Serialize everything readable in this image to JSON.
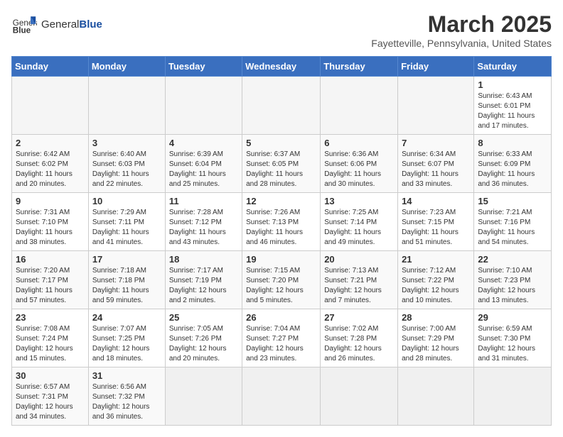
{
  "header": {
    "logo_text_normal": "General",
    "logo_text_bold": "Blue",
    "month_year": "March 2025",
    "location": "Fayetteville, Pennsylvania, United States"
  },
  "days_of_week": [
    "Sunday",
    "Monday",
    "Tuesday",
    "Wednesday",
    "Thursday",
    "Friday",
    "Saturday"
  ],
  "weeks": [
    [
      {
        "day": null,
        "info": null
      },
      {
        "day": null,
        "info": null
      },
      {
        "day": null,
        "info": null
      },
      {
        "day": null,
        "info": null
      },
      {
        "day": null,
        "info": null
      },
      {
        "day": null,
        "info": null
      },
      {
        "day": "1",
        "info": "Sunrise: 6:43 AM\nSunset: 6:01 PM\nDaylight: 11 hours and 17 minutes."
      }
    ],
    [
      {
        "day": "2",
        "info": "Sunrise: 6:42 AM\nSunset: 6:02 PM\nDaylight: 11 hours and 20 minutes."
      },
      {
        "day": "3",
        "info": "Sunrise: 6:40 AM\nSunset: 6:03 PM\nDaylight: 11 hours and 22 minutes."
      },
      {
        "day": "4",
        "info": "Sunrise: 6:39 AM\nSunset: 6:04 PM\nDaylight: 11 hours and 25 minutes."
      },
      {
        "day": "5",
        "info": "Sunrise: 6:37 AM\nSunset: 6:05 PM\nDaylight: 11 hours and 28 minutes."
      },
      {
        "day": "6",
        "info": "Sunrise: 6:36 AM\nSunset: 6:06 PM\nDaylight: 11 hours and 30 minutes."
      },
      {
        "day": "7",
        "info": "Sunrise: 6:34 AM\nSunset: 6:07 PM\nDaylight: 11 hours and 33 minutes."
      },
      {
        "day": "8",
        "info": "Sunrise: 6:33 AM\nSunset: 6:09 PM\nDaylight: 11 hours and 36 minutes."
      }
    ],
    [
      {
        "day": "9",
        "info": "Sunrise: 7:31 AM\nSunset: 7:10 PM\nDaylight: 11 hours and 38 minutes."
      },
      {
        "day": "10",
        "info": "Sunrise: 7:29 AM\nSunset: 7:11 PM\nDaylight: 11 hours and 41 minutes."
      },
      {
        "day": "11",
        "info": "Sunrise: 7:28 AM\nSunset: 7:12 PM\nDaylight: 11 hours and 43 minutes."
      },
      {
        "day": "12",
        "info": "Sunrise: 7:26 AM\nSunset: 7:13 PM\nDaylight: 11 hours and 46 minutes."
      },
      {
        "day": "13",
        "info": "Sunrise: 7:25 AM\nSunset: 7:14 PM\nDaylight: 11 hours and 49 minutes."
      },
      {
        "day": "14",
        "info": "Sunrise: 7:23 AM\nSunset: 7:15 PM\nDaylight: 11 hours and 51 minutes."
      },
      {
        "day": "15",
        "info": "Sunrise: 7:21 AM\nSunset: 7:16 PM\nDaylight: 11 hours and 54 minutes."
      }
    ],
    [
      {
        "day": "16",
        "info": "Sunrise: 7:20 AM\nSunset: 7:17 PM\nDaylight: 11 hours and 57 minutes."
      },
      {
        "day": "17",
        "info": "Sunrise: 7:18 AM\nSunset: 7:18 PM\nDaylight: 11 hours and 59 minutes."
      },
      {
        "day": "18",
        "info": "Sunrise: 7:17 AM\nSunset: 7:19 PM\nDaylight: 12 hours and 2 minutes."
      },
      {
        "day": "19",
        "info": "Sunrise: 7:15 AM\nSunset: 7:20 PM\nDaylight: 12 hours and 5 minutes."
      },
      {
        "day": "20",
        "info": "Sunrise: 7:13 AM\nSunset: 7:21 PM\nDaylight: 12 hours and 7 minutes."
      },
      {
        "day": "21",
        "info": "Sunrise: 7:12 AM\nSunset: 7:22 PM\nDaylight: 12 hours and 10 minutes."
      },
      {
        "day": "22",
        "info": "Sunrise: 7:10 AM\nSunset: 7:23 PM\nDaylight: 12 hours and 13 minutes."
      }
    ],
    [
      {
        "day": "23",
        "info": "Sunrise: 7:08 AM\nSunset: 7:24 PM\nDaylight: 12 hours and 15 minutes."
      },
      {
        "day": "24",
        "info": "Sunrise: 7:07 AM\nSunset: 7:25 PM\nDaylight: 12 hours and 18 minutes."
      },
      {
        "day": "25",
        "info": "Sunrise: 7:05 AM\nSunset: 7:26 PM\nDaylight: 12 hours and 20 minutes."
      },
      {
        "day": "26",
        "info": "Sunrise: 7:04 AM\nSunset: 7:27 PM\nDaylight: 12 hours and 23 minutes."
      },
      {
        "day": "27",
        "info": "Sunrise: 7:02 AM\nSunset: 7:28 PM\nDaylight: 12 hours and 26 minutes."
      },
      {
        "day": "28",
        "info": "Sunrise: 7:00 AM\nSunset: 7:29 PM\nDaylight: 12 hours and 28 minutes."
      },
      {
        "day": "29",
        "info": "Sunrise: 6:59 AM\nSunset: 7:30 PM\nDaylight: 12 hours and 31 minutes."
      }
    ],
    [
      {
        "day": "30",
        "info": "Sunrise: 6:57 AM\nSunset: 7:31 PM\nDaylight: 12 hours and 34 minutes."
      },
      {
        "day": "31",
        "info": "Sunrise: 6:56 AM\nSunset: 7:32 PM\nDaylight: 12 hours and 36 minutes."
      },
      {
        "day": null,
        "info": null
      },
      {
        "day": null,
        "info": null
      },
      {
        "day": null,
        "info": null
      },
      {
        "day": null,
        "info": null
      },
      {
        "day": null,
        "info": null
      }
    ]
  ]
}
